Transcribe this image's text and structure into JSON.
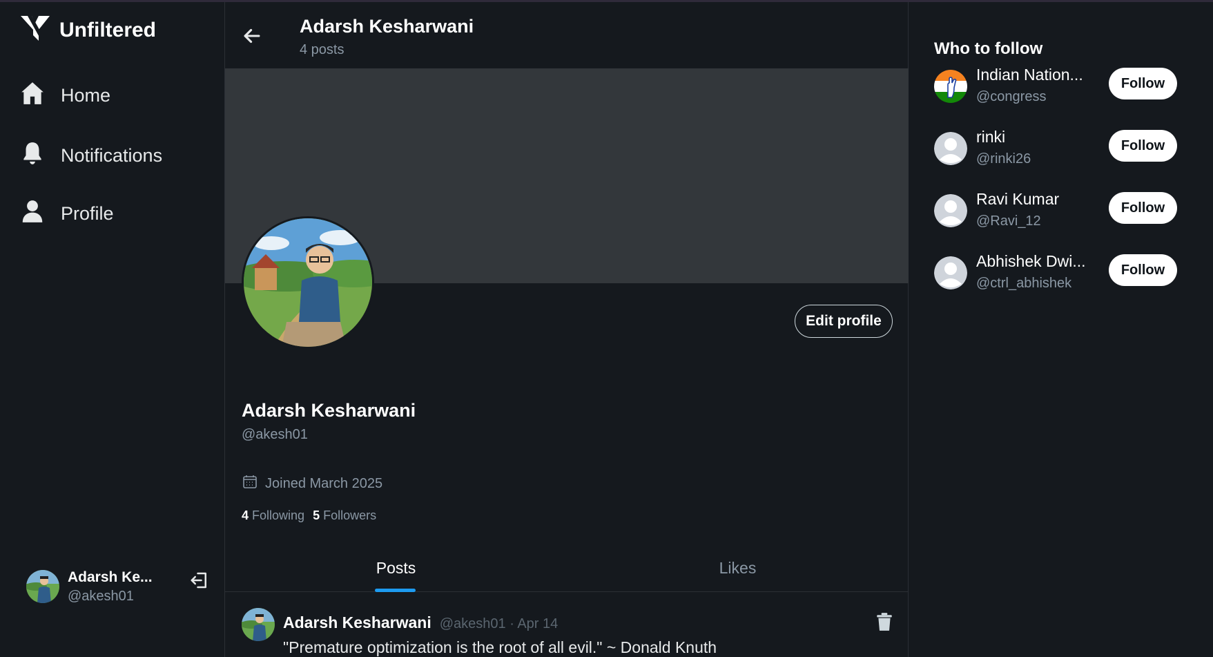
{
  "app": {
    "name": "Unfiltered"
  },
  "sidebar": {
    "items": [
      {
        "label": "Home",
        "icon": "home-icon"
      },
      {
        "label": "Notifications",
        "icon": "bell-icon"
      },
      {
        "label": "Profile",
        "icon": "user-icon"
      }
    ],
    "user": {
      "name": "Adarsh Ke...",
      "handle": "@akesh01"
    }
  },
  "header": {
    "title": "Adarsh Kesharwani",
    "subtitle": "4 posts"
  },
  "profile": {
    "name": "Adarsh Kesharwani",
    "handle": "@akesh01",
    "joined": "Joined March 2025",
    "following_count": "4",
    "following_label": "Following",
    "followers_count": "5",
    "followers_label": "Followers",
    "edit_label": "Edit profile"
  },
  "tabs": [
    {
      "label": "Posts",
      "active": true
    },
    {
      "label": "Likes",
      "active": false
    }
  ],
  "posts": [
    {
      "author": "Adarsh Kesharwani",
      "meta": "@akesh01 · Apr 14",
      "text": "\"Premature optimization is the root of all evil.\" ~ Donald Knuth"
    }
  ],
  "who_to_follow": {
    "title": "Who to follow",
    "button_label": "Follow",
    "users": [
      {
        "name": "Indian Nation...",
        "handle": "@congress",
        "avatar": "party-logo"
      },
      {
        "name": "rinki",
        "handle": "@rinki26",
        "avatar": "default-avatar"
      },
      {
        "name": "Ravi Kumar",
        "handle": "@Ravi_12",
        "avatar": "default-avatar"
      },
      {
        "name": "Abhishek Dwi...",
        "handle": "@ctrl_abhishek",
        "avatar": "default-avatar"
      }
    ]
  },
  "colors": {
    "background": "#15191e",
    "banner": "#33373b",
    "accent": "#1d9bf0",
    "muted_text": "#8b98a5",
    "divider": "#2b2f35"
  }
}
